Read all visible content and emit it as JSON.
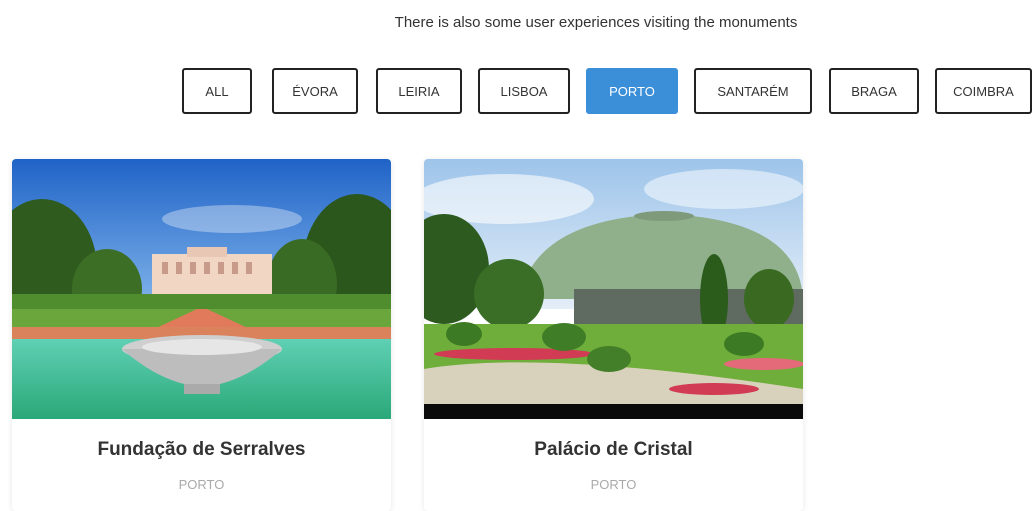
{
  "intro_text": "There is also some user experiences visiting the monuments",
  "filters": [
    "ALL",
    "ÉVORA",
    "LEIRIA",
    "LISBOA",
    "PORTO",
    "SANTARÉM",
    "BRAGA",
    "COIMBRA"
  ],
  "active_filter": "PORTO",
  "colors": {
    "accent": "#3b8fd9",
    "border": "#222222",
    "subtitle": "#aaaaaa"
  },
  "cards": [
    {
      "title": "Fundação de Serralves",
      "city": "PORTO"
    },
    {
      "title": "Palácio de Cristal",
      "city": "PORTO"
    }
  ]
}
